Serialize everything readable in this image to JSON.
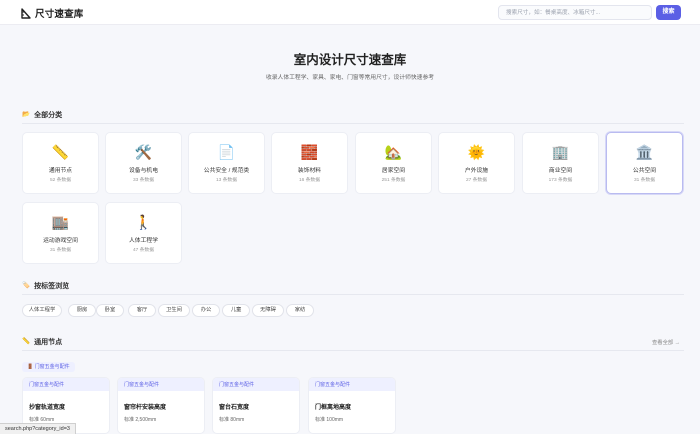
{
  "header": {
    "logo_text": "尺寸速查库",
    "search_placeholder": "搜索尺寸，如：餐桌高度、冰箱尺寸...",
    "search_button": "搜索"
  },
  "hero": {
    "title": "室内设计尺寸速查库",
    "subtitle": "收录人体工程学、家具、家电、门窗等常用尺寸，设计师快速参考"
  },
  "categories_section": {
    "title": "全部分类",
    "items": [
      {
        "icon": "📏",
        "name": "通用节点",
        "count": "52 条数据"
      },
      {
        "icon": "🛠️",
        "name": "设备与机电",
        "count": "33 条数据"
      },
      {
        "icon": "📄",
        "name": "公共安全 / 规范类",
        "count": "13 条数据"
      },
      {
        "icon": "🧱",
        "name": "装饰材料",
        "count": "16 条数据"
      },
      {
        "icon": "🏡",
        "name": "居家空间",
        "count": "251 条数据"
      },
      {
        "icon": "🌞",
        "name": "户外设施",
        "count": "27 条数据"
      },
      {
        "icon": "🏢",
        "name": "商业空间",
        "count": "173 条数据"
      },
      {
        "icon": "🏛️",
        "name": "公共空间",
        "count": "31 条数据"
      },
      {
        "icon": "🏬",
        "name": "运动游戏空间",
        "count": "31 条数据"
      },
      {
        "icon": "🚶",
        "name": "人体工程学",
        "count": "47 条数据"
      }
    ]
  },
  "tags_section": {
    "title": "按标签浏览",
    "tags": [
      "人体工程学",
      "厨房",
      "卧室",
      "客厅",
      "卫生间",
      "办公",
      "儿童",
      "无障碍",
      "家纺"
    ]
  },
  "general_section": {
    "title": "通用节点",
    "view_all": "查看全部 →",
    "sub_badge": "门窗五金与配件",
    "items": [
      {
        "badge": "门窗五金与配件",
        "title": "抄窗轨道宽度",
        "std": "标准 60mm"
      },
      {
        "badge": "门窗五金与配件",
        "title": "窗帘杆安装高度",
        "std": "标准 2,500mm"
      },
      {
        "badge": "门窗五金与配件",
        "title": "窗台石宽度",
        "std": "标准 80mm"
      },
      {
        "badge": "门窗五金与配件",
        "title": "门框离地高度",
        "std": "标准 100mm"
      }
    ]
  },
  "statusbar": {
    "url": "search.php?category_id=3"
  },
  "colors": {
    "accent": "#5b5fe5",
    "background": "#f6f7fb"
  }
}
